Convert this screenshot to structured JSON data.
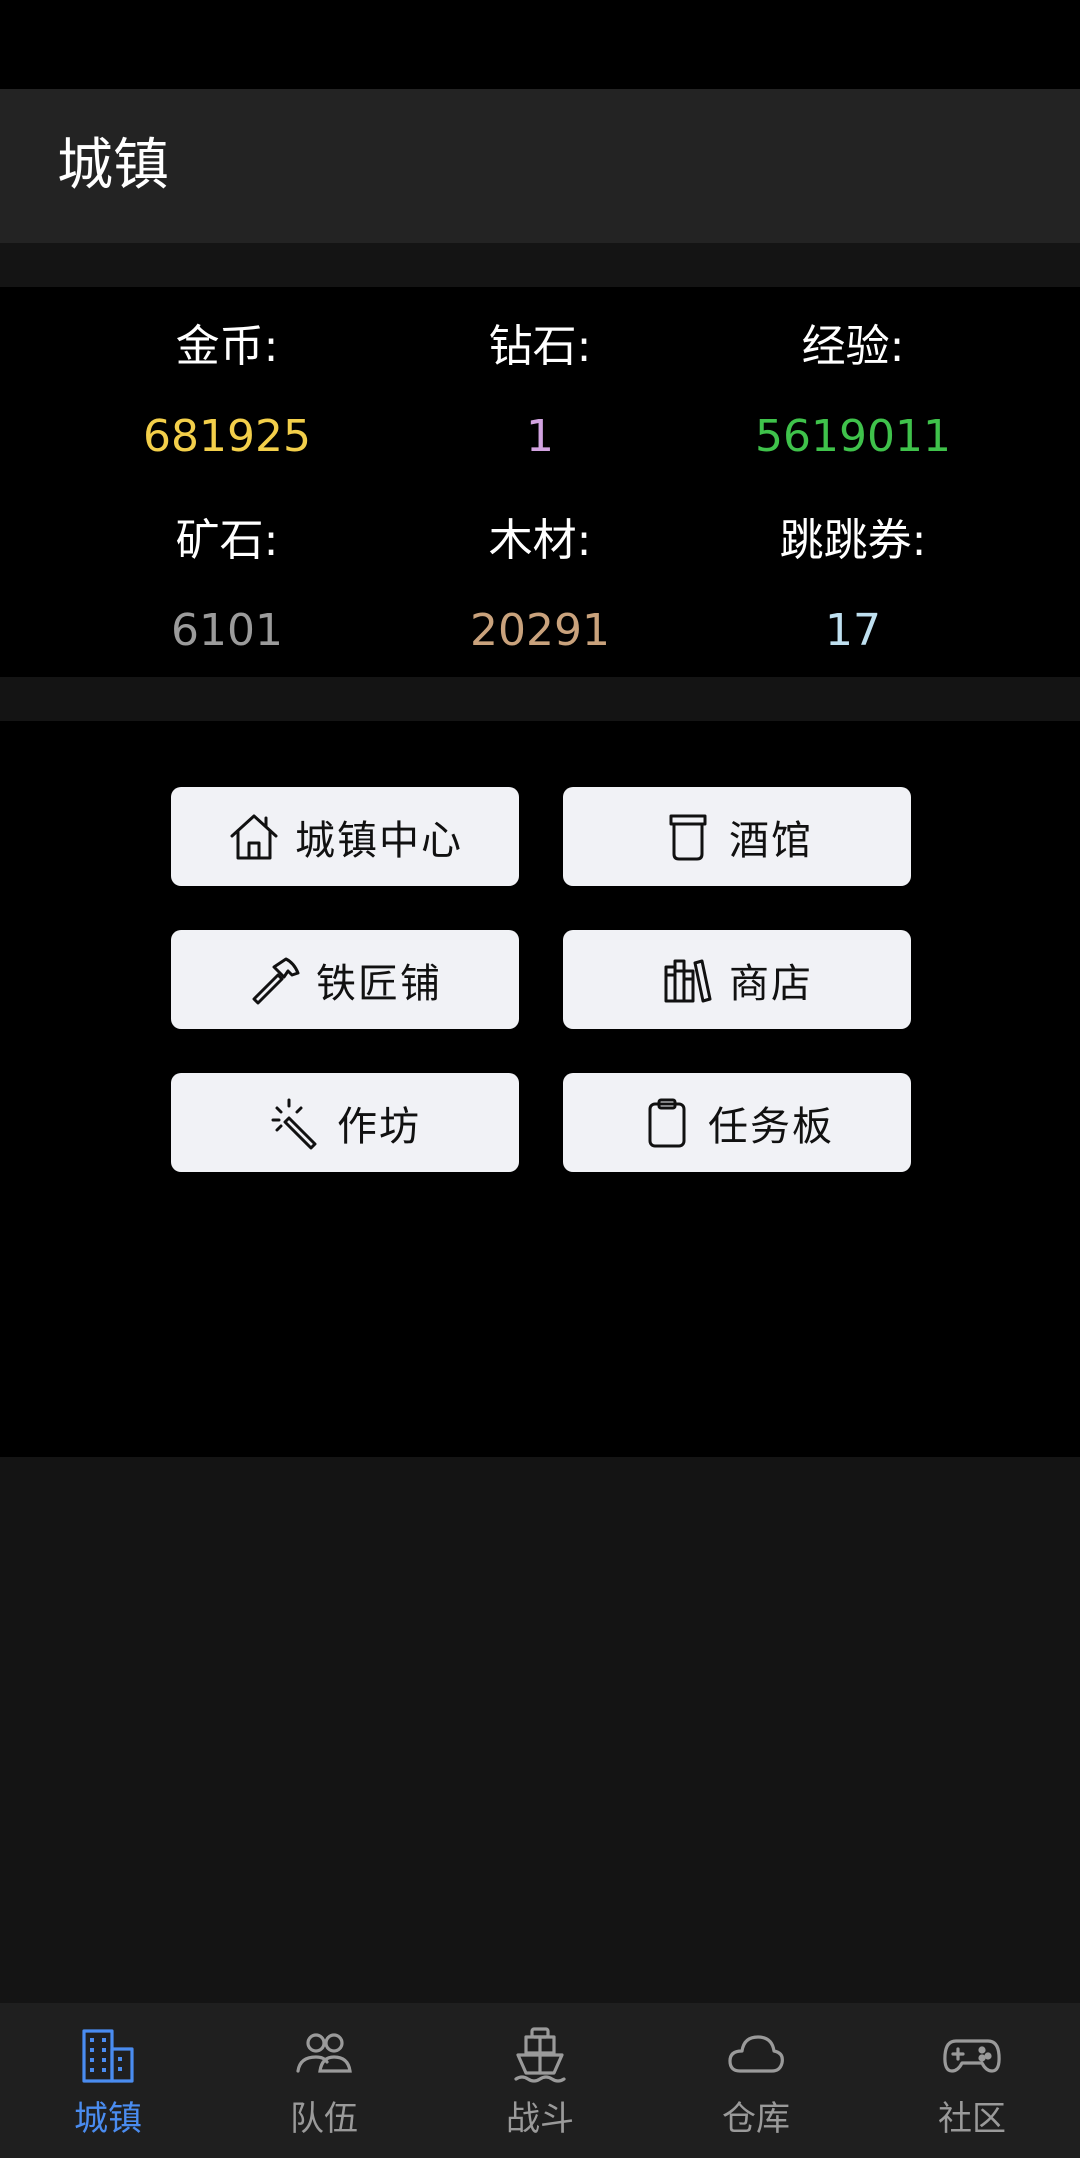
{
  "header": {
    "title": "城镇"
  },
  "stats": [
    {
      "label": "金币:",
      "value": "681925",
      "color": "#f3cf4a"
    },
    {
      "label": "钻石:",
      "value": "1",
      "color": "#d2a3e0"
    },
    {
      "label": "经验:",
      "value": "5619011",
      "color": "#3fc24b"
    },
    {
      "label": "矿石:",
      "value": "6101",
      "color": "#9b9b9b"
    },
    {
      "label": "木材:",
      "value": "20291",
      "color": "#c9a27c"
    },
    {
      "label": "跳跳券:",
      "value": "17",
      "color": "#bfe0f0"
    }
  ],
  "menu": [
    {
      "label": "城镇中心",
      "icon": "house-icon"
    },
    {
      "label": "酒馆",
      "icon": "cup-icon"
    },
    {
      "label": "铁匠铺",
      "icon": "hammer-icon"
    },
    {
      "label": "商店",
      "icon": "books-icon"
    },
    {
      "label": "作坊",
      "icon": "magic-wand-icon"
    },
    {
      "label": "任务板",
      "icon": "clipboard-icon"
    }
  ],
  "tabs": [
    {
      "label": "城镇",
      "icon": "buildings-icon",
      "active": true
    },
    {
      "label": "队伍",
      "icon": "people-icon",
      "active": false
    },
    {
      "label": "战斗",
      "icon": "ship-icon",
      "active": false
    },
    {
      "label": "仓库",
      "icon": "cloud-icon",
      "active": false
    },
    {
      "label": "社区",
      "icon": "gamepad-icon",
      "active": false
    }
  ],
  "colors": {
    "accent": "#4a8cf0",
    "tab_inactive": "#9a9a9a"
  }
}
